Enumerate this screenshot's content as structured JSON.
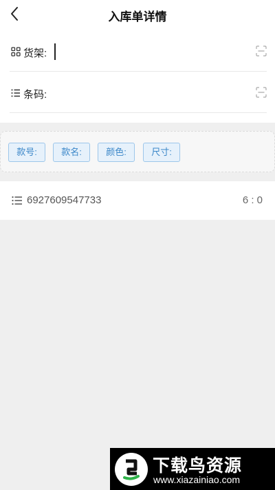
{
  "header": {
    "title": "入库单详情"
  },
  "form": {
    "shelf": {
      "label": "货架:",
      "value": "",
      "placeholder": ""
    },
    "barcode": {
      "label": "条码:",
      "value": "",
      "placeholder": ""
    }
  },
  "tags": {
    "style_no": "款号:",
    "style_name": "款名:",
    "color": "颜色:",
    "size": "尺寸:"
  },
  "items": [
    {
      "barcode": "6927609547733",
      "count": "6 : 0"
    }
  ],
  "watermark": {
    "title": "下载鸟资源",
    "url": "www.xiazainiao.com"
  },
  "colors": {
    "tag_text": "#3a86c8",
    "tag_bg": "#e6f1fb",
    "page_bg": "#efefef"
  }
}
